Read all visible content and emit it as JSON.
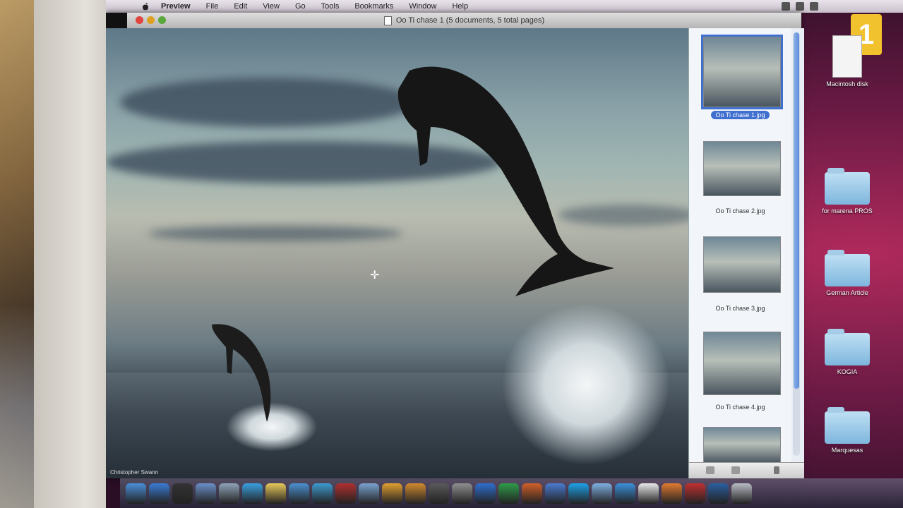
{
  "menu": {
    "app": "Preview",
    "items": [
      "File",
      "Edit",
      "View",
      "Go",
      "Tools",
      "Bookmarks",
      "Window",
      "Help"
    ]
  },
  "window": {
    "title": "Oo Ti chase 1 (5 documents, 5 total pages)"
  },
  "photo": {
    "credit": "Christopher Swann"
  },
  "sidebar": {
    "thumbnails": [
      {
        "label": "Oo Ti chase 1.jpg",
        "selected": true
      },
      {
        "label": "Oo Ti chase 2.jpg",
        "selected": false
      },
      {
        "label": "Oo Ti chase 3.jpg",
        "selected": false
      },
      {
        "label": "Oo Ti chase 4.jpg",
        "selected": false
      },
      {
        "label": "",
        "selected": false
      }
    ]
  },
  "desktop": {
    "items": [
      {
        "label": "Macintosh disk",
        "icon": "document-icon"
      },
      {
        "label": "for marena PROS",
        "icon": "folder-icon"
      },
      {
        "label": "German Article",
        "icon": "folder-icon"
      },
      {
        "label": "KOGIA",
        "icon": "folder-icon"
      },
      {
        "label": "Marquesas",
        "icon": "folder-icon"
      }
    ],
    "channel_logo": "1"
  },
  "dock": {
    "icons": [
      "finder-icon",
      "safari-icon",
      "dashboard-icon",
      "address-book-icon",
      "system-prefs-icon",
      "ichat-icon",
      "notes-icon",
      "preview-icon",
      "itunes-icon",
      "photo-booth-icon",
      "iphoto-icon",
      "star-icon",
      "garageband-icon",
      "time-machine-icon",
      "spaces-icon",
      "word-icon",
      "excel-icon",
      "powerpoint-icon",
      "entourage-icon",
      "skype-icon",
      "folder-icon",
      "globe-icon",
      "document-icon",
      "firefox-icon",
      "flash-icon",
      "photoshop-icon",
      "trash-icon"
    ]
  }
}
